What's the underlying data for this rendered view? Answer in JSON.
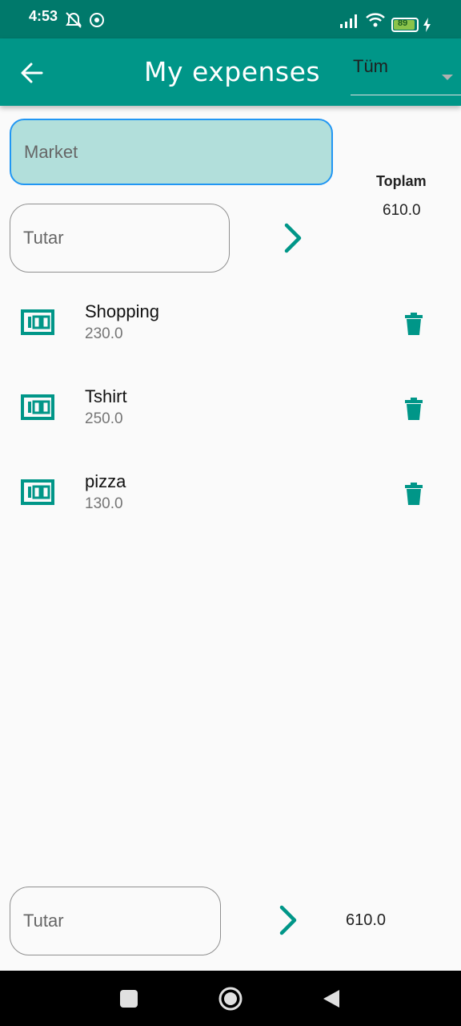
{
  "status_bar": {
    "time": "4:53",
    "battery": "89"
  },
  "app_bar": {
    "back_label": "back",
    "title": "My expenses",
    "filter_value": "Tüm"
  },
  "form": {
    "name_placeholder": "Market",
    "amount_placeholder": "Tutar"
  },
  "summary": {
    "total_label": "Toplam",
    "total_value": "610.0"
  },
  "expenses": [
    {
      "name": "Shopping",
      "amount": "230.0",
      "icon": "money-icon"
    },
    {
      "name": "Tshirt",
      "amount": "250.0",
      "icon": "money-icon"
    },
    {
      "name": "pizza",
      "amount": "130.0",
      "icon": "money-icon"
    }
  ],
  "footer": {
    "amount_placeholder": "Tutar",
    "total_value": "610.0"
  },
  "colors": {
    "primary": "#009688",
    "primary_dark": "#00796b",
    "field_fill": "#b2dfdb",
    "focus_border": "#2196f3"
  }
}
